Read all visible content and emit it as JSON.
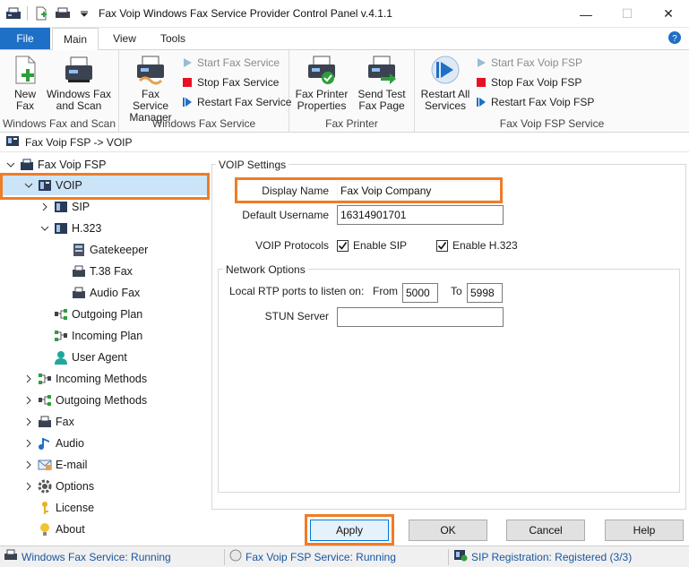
{
  "window": {
    "title": "Fax Voip Windows Fax Service Provider Control Panel v.4.1.1",
    "minimize": "—",
    "maximize": "☐",
    "close": "✕"
  },
  "tabs": {
    "file": "File",
    "main": "Main",
    "view": "View",
    "tools": "Tools"
  },
  "ribbon": {
    "windows_fax_scan": {
      "label": "Windows Fax and Scan",
      "new_fax": [
        "New",
        "Fax"
      ],
      "wfs": [
        "Windows Fax",
        "and Scan"
      ]
    },
    "windows_fax_service": {
      "label": "Windows Fax Service",
      "manager": [
        "Fax Service",
        "Manager"
      ],
      "start": "Start Fax Service",
      "stop": "Stop Fax Service",
      "restart": "Restart Fax Service"
    },
    "fax_printer": {
      "label": "Fax Printer",
      "props": [
        "Fax Printer",
        "Properties"
      ],
      "test": [
        "Send Test",
        "Fax Page"
      ]
    },
    "fsp_service": {
      "label": "Fax Voip FSP Service",
      "restart_all": [
        "Restart All",
        "Services"
      ],
      "start": "Start Fax Voip FSP",
      "stop": "Stop Fax Voip FSP",
      "restart": "Restart Fax Voip FSP"
    }
  },
  "breadcrumb": "Fax Voip FSP -> VOIP",
  "tree": {
    "root": "Fax Voip FSP",
    "voip": "VOIP",
    "sip": "SIP",
    "h323": "H.323",
    "gatekeeper": "Gatekeeper",
    "t38": "T.38 Fax",
    "audio_fax": "Audio Fax",
    "outgoing_plan": "Outgoing Plan",
    "incoming_plan": "Incoming Plan",
    "user_agent": "User Agent",
    "incoming_methods": "Incoming Methods",
    "outgoing_methods": "Outgoing Methods",
    "fax": "Fax",
    "audio": "Audio",
    "email": "E-mail",
    "options": "Options",
    "license": "License",
    "about": "About"
  },
  "voip_settings": {
    "legend": "VOIP Settings",
    "display_name_label": "Display Name",
    "display_name_value": "Fax Voip Company",
    "default_username_label": "Default Username",
    "default_username_value": "16314901701",
    "protocols_label": "VOIP Protocols",
    "enable_sip": "Enable SIP",
    "enable_h323": "Enable H.323",
    "enable_sip_checked": true,
    "enable_h323_checked": true
  },
  "network_options": {
    "legend": "Network Options",
    "rtp_label": "Local RTP ports to listen on:",
    "from_label": "From",
    "from_value": "5000",
    "to_label": "To",
    "to_value": "5998",
    "stun_label": "STUN Server",
    "stun_value": ""
  },
  "buttons": {
    "apply": "Apply",
    "ok": "OK",
    "cancel": "Cancel",
    "help": "Help"
  },
  "status": {
    "wfs": "Windows Fax Service: Running",
    "fsp": "Fax Voip FSP Service: Running",
    "sip": "SIP Registration: Registered (3/3)"
  },
  "colors": {
    "accent": "#1e6fc6",
    "highlight": "#f07c26",
    "selected": "#cce4f7",
    "stop_red": "#e81123",
    "link_blue": "#1a56a0"
  }
}
